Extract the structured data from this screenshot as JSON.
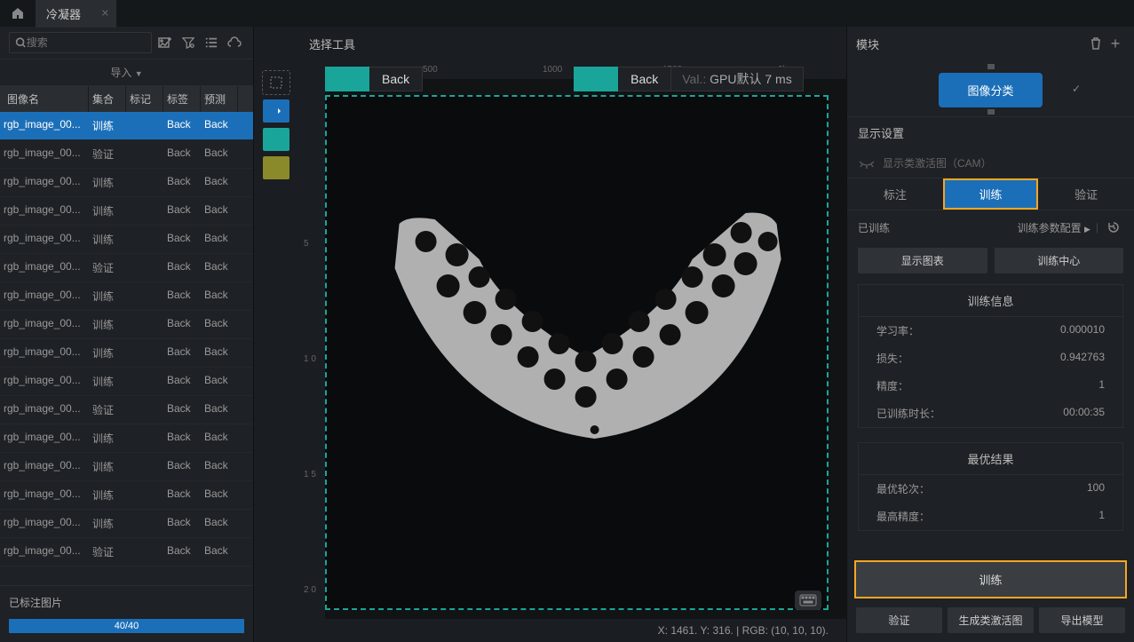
{
  "tab_title": "冷凝器",
  "search_placeholder": "搜索",
  "import_label": "导入",
  "columns": {
    "name": "图像名",
    "set": "集合",
    "mark": "标记",
    "tag": "标签",
    "pred": "预测"
  },
  "rows": [
    {
      "name": "rgb_image_00...",
      "set": "训练",
      "tag": "Back",
      "pred": "Back",
      "selected": true
    },
    {
      "name": "rgb_image_00...",
      "set": "验证",
      "tag": "Back",
      "pred": "Back"
    },
    {
      "name": "rgb_image_00...",
      "set": "训练",
      "tag": "Back",
      "pred": "Back"
    },
    {
      "name": "rgb_image_00...",
      "set": "训练",
      "tag": "Back",
      "pred": "Back"
    },
    {
      "name": "rgb_image_00...",
      "set": "训练",
      "tag": "Back",
      "pred": "Back"
    },
    {
      "name": "rgb_image_00...",
      "set": "验证",
      "tag": "Back",
      "pred": "Back"
    },
    {
      "name": "rgb_image_00...",
      "set": "训练",
      "tag": "Back",
      "pred": "Back"
    },
    {
      "name": "rgb_image_00...",
      "set": "训练",
      "tag": "Back",
      "pred": "Back"
    },
    {
      "name": "rgb_image_00...",
      "set": "训练",
      "tag": "Back",
      "pred": "Back"
    },
    {
      "name": "rgb_image_00...",
      "set": "训练",
      "tag": "Back",
      "pred": "Back"
    },
    {
      "name": "rgb_image_00...",
      "set": "验证",
      "tag": "Back",
      "pred": "Back"
    },
    {
      "name": "rgb_image_00...",
      "set": "训练",
      "tag": "Back",
      "pred": "Back"
    },
    {
      "name": "rgb_image_00...",
      "set": "训练",
      "tag": "Back",
      "pred": "Back"
    },
    {
      "name": "rgb_image_00...",
      "set": "训练",
      "tag": "Back",
      "pred": "Back"
    },
    {
      "name": "rgb_image_00...",
      "set": "训练",
      "tag": "Back",
      "pred": "Back"
    },
    {
      "name": "rgb_image_00...",
      "set": "验证",
      "tag": "Back",
      "pred": "Back"
    }
  ],
  "annotated_label": "已标注图片",
  "progress_text": "40/40",
  "center_title": "选择工具",
  "ruler_h": [
    "500",
    "1000",
    "1500",
    "2k"
  ],
  "ruler_v": [
    "5",
    "1 0",
    "1 5",
    "2 0"
  ],
  "tag1": "Back",
  "tag2": "Back",
  "val_prefix": "Val.:",
  "val_text": "GPU默认 7 ms",
  "status_text": "X: 1461. Y: 316. | RGB: (10, 10, 10).",
  "right": {
    "module_hdr": "模块",
    "module_btn": "图像分类",
    "display_hdr": "显示设置",
    "cam_label": "显示类激活图（CAM）",
    "tabs": {
      "label": "标注",
      "train": "训练",
      "valid": "验证"
    },
    "trained_label": "已训练",
    "train_cfg": "训练参数配置",
    "show_chart": "显示图表",
    "train_center": "训练中心",
    "info_title": "训练信息",
    "info": [
      {
        "k": "学习率：",
        "v": "0.000010"
      },
      {
        "k": "损失：",
        "v": "0.942763"
      },
      {
        "k": "精度：",
        "v": "1"
      },
      {
        "k": "已训练时长：",
        "v": "00:00:35"
      }
    ],
    "best_title": "最优结果",
    "best": [
      {
        "k": "最优轮次：",
        "v": "100"
      },
      {
        "k": "最高精度：",
        "v": "1"
      }
    ],
    "train_btn": "训练",
    "actions": {
      "valid": "验证",
      "cam": "生成类激活图",
      "export": "导出模型"
    }
  }
}
